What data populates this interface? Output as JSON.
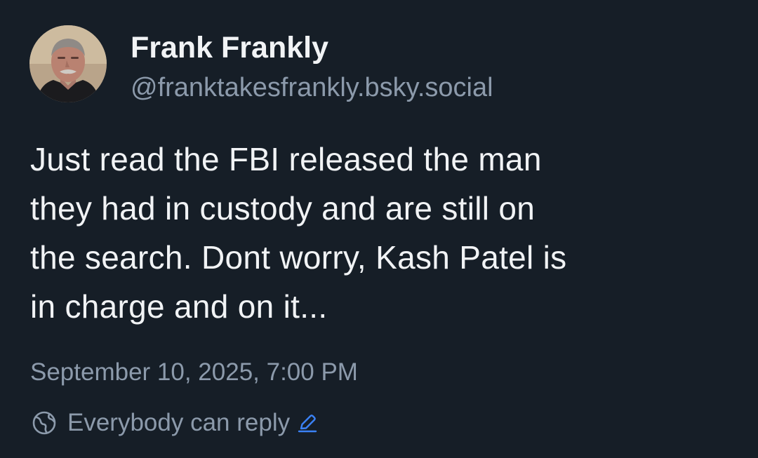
{
  "author": {
    "display_name": "Frank Frankly",
    "handle": "@franktakesfrankly.bsky.social",
    "avatar_icon": "avatar-photo"
  },
  "post": {
    "text_lines": [
      "Just read the FBI released the man",
      "they had in custody and are still on",
      "the search. Dont worry, Kash Patel is",
      "in charge and on it..."
    ],
    "timestamp": "September 10, 2025, 7:00 PM"
  },
  "reply_settings": {
    "label": "Everybody can reply",
    "icon": "globe-icon",
    "edit_icon": "pencil-icon"
  },
  "colors": {
    "background": "#161e27",
    "text_primary": "#f1f3f5",
    "text_secondary": "#8c9aab",
    "accent": "#3b82f6"
  }
}
